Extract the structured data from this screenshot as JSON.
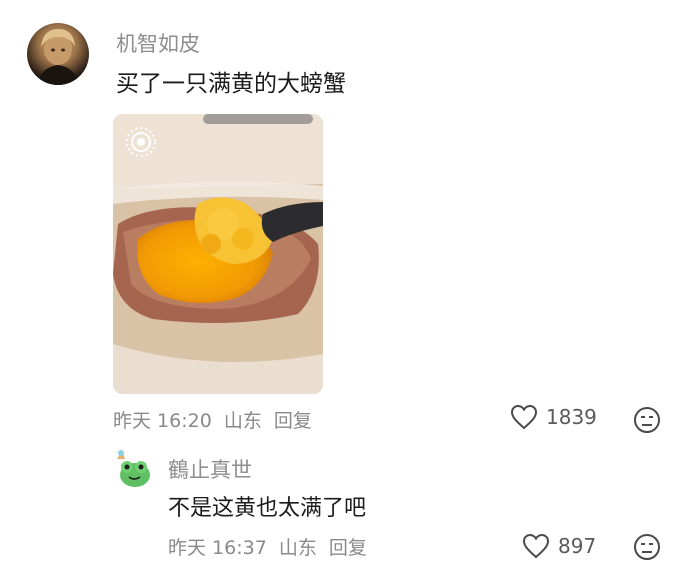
{
  "main_comment": {
    "username": "机智如皮",
    "text": "买了一只满黄的大螃蟹",
    "time": "昨天 16:20",
    "location": "山东",
    "reply_label": "回复",
    "likes": "1839"
  },
  "reply_comment": {
    "username": "鶴止真世",
    "text": "不是这黄也太满了吧",
    "time": "昨天 16:37",
    "location": "山东",
    "reply_label": "回复",
    "likes": "897"
  },
  "icons": {
    "like": "heart-icon",
    "dislike": "unhappy-face-icon",
    "photo_badge": "live-photo-icon"
  },
  "colors": {
    "username": "#8e8e8e",
    "text": "#1b1b1b",
    "meta": "#8a8a8a",
    "icon": "#5a5a5a"
  }
}
